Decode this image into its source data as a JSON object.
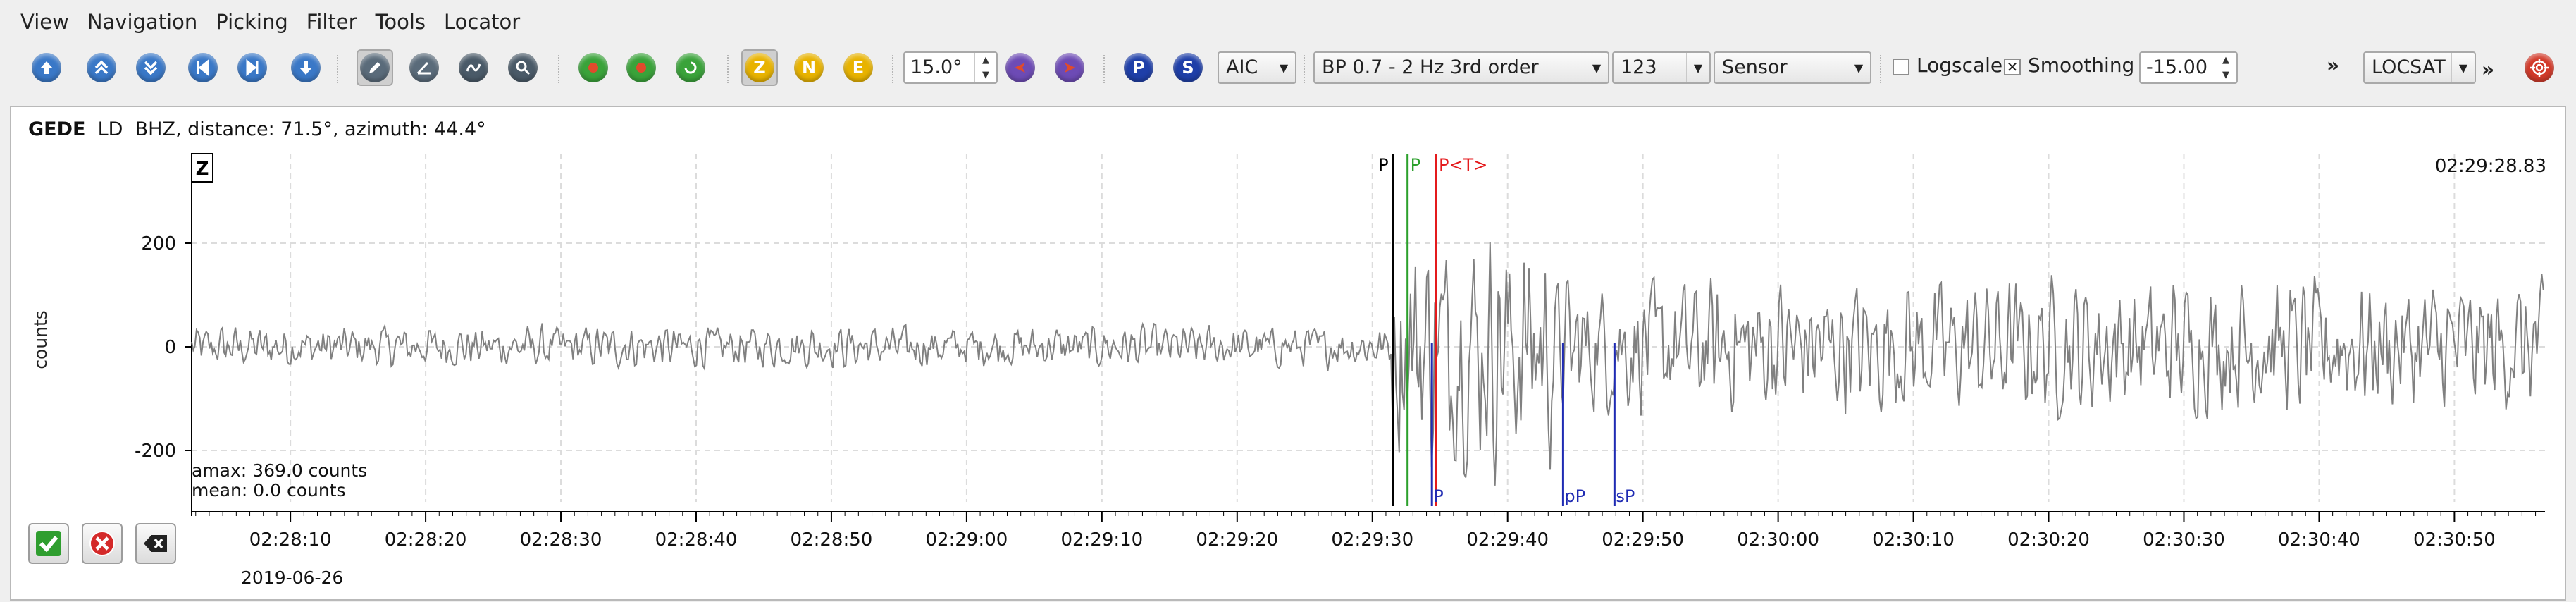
{
  "menu": [
    "View",
    "Navigation",
    "Picking",
    "Filter",
    "Tools",
    "Locator"
  ],
  "toolbar": {
    "component_z": "Z",
    "component_n": "N",
    "component_e": "E",
    "rotation": "15.0°",
    "pick_p": "P",
    "pick_s": "S",
    "picker_method": "AIC",
    "filter": "BP 0.7 - 2 Hz  3rd order",
    "channel": "123",
    "unit": "Sensor",
    "logscale_label": "Logscale",
    "logscale_checked": false,
    "smoothing_label": "Smoothing",
    "smoothing_checked": true,
    "smoothing_checkmark": "✕",
    "offset_value": "-15.00",
    "overflow": "»",
    "locator": "LOCSAT",
    "overflow2": "»"
  },
  "trace": {
    "station": "GEDE",
    "network": "LD",
    "channel": "BHZ",
    "info": "distance: 71.5°, azimuth: 44.4°",
    "component_label": "Z",
    "cursor_time": "02:29:28.83",
    "ylabel": "counts",
    "y_ticks": [
      "200",
      "0",
      "-200"
    ],
    "amax": "amax: 369.0 counts",
    "mean": "mean: 0.0 counts",
    "date": "2019-06-26",
    "time_ticks": [
      "02:28:10",
      "02:28:20",
      "02:28:30",
      "02:28:40",
      "02:28:50",
      "02:29:00",
      "02:29:10",
      "02:29:20",
      "02:29:30",
      "02:29:40",
      "02:29:50",
      "02:30:00",
      "02:30:10",
      "02:30:20",
      "02:30:30",
      "02:30:40",
      "02:30:50"
    ],
    "picks": [
      {
        "label": "P",
        "time": 88.8,
        "color": "#000000",
        "position": "top"
      },
      {
        "label": "P",
        "time": 89.9,
        "color": "#2ca02c",
        "position": "top"
      },
      {
        "label": "P<T>",
        "time": 92.0,
        "color": "#e41a1c",
        "position": "top"
      },
      {
        "label": "P",
        "time": 91.7,
        "color": "#1f2bb3",
        "position": "bottom"
      },
      {
        "label": "pP",
        "time": 101.4,
        "color": "#1f2bb3",
        "position": "bottom"
      },
      {
        "label": "sP",
        "time": 105.2,
        "color": "#1f2bb3",
        "position": "bottom"
      }
    ],
    "time_start": 0,
    "time_end": 174,
    "first_tick_offset": 7.3,
    "y_min": -300,
    "y_max": 370
  },
  "colors": {
    "trace": "#808080",
    "grid": "#dcdcdc",
    "accent_yellow": "#e8b300",
    "pick_blue": "#1f2bb3",
    "pick_red": "#e41a1c",
    "pick_green": "#2ca02c"
  }
}
